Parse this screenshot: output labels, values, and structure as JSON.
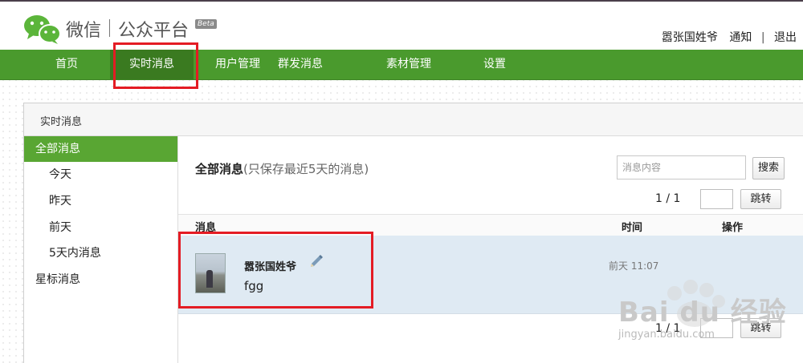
{
  "header": {
    "logo_text": "微信",
    "platform_text": "公众平台",
    "beta": "Beta",
    "user": {
      "name": "嚣张国姓爷",
      "notify": "通知",
      "sep": "|",
      "logout": "退出"
    }
  },
  "nav": {
    "items": [
      {
        "label": "首页"
      },
      {
        "label": "实时消息",
        "active": true
      },
      {
        "label": "用户管理"
      },
      {
        "label": "群发消息"
      },
      {
        "label": "素材管理"
      },
      {
        "label": "设置"
      }
    ]
  },
  "panel": {
    "title": "实时消息"
  },
  "sidebar": {
    "items": [
      {
        "label": "全部消息",
        "active": true
      },
      {
        "label": "今天"
      },
      {
        "label": "昨天"
      },
      {
        "label": "前天"
      },
      {
        "label": "5天内消息"
      },
      {
        "label": "星标消息"
      }
    ]
  },
  "main": {
    "heading": "全部消息",
    "heading_note": "(只保存最近5天的消息)",
    "search": {
      "placeholder": "消息内容",
      "button": "搜索"
    },
    "pagination_top": {
      "info": "1 / 1",
      "jump": "跳转"
    },
    "pagination_bottom": {
      "info": "1 / 1",
      "jump": "跳转"
    },
    "table": {
      "col_message": "消息",
      "col_time": "时间",
      "col_action": "操作"
    },
    "messages": [
      {
        "sender": "嚣张国姓爷",
        "text": "fgg",
        "time": "前天 11:07"
      }
    ]
  },
  "watermark": {
    "brand": "Bai du 经验",
    "url": "jingyan.baidu.com"
  },
  "colors": {
    "nav_green": "#4a9a2d",
    "active_green": "#59a633",
    "highlight_red": "#e41c24",
    "row_bg": "#dfeaf3"
  }
}
